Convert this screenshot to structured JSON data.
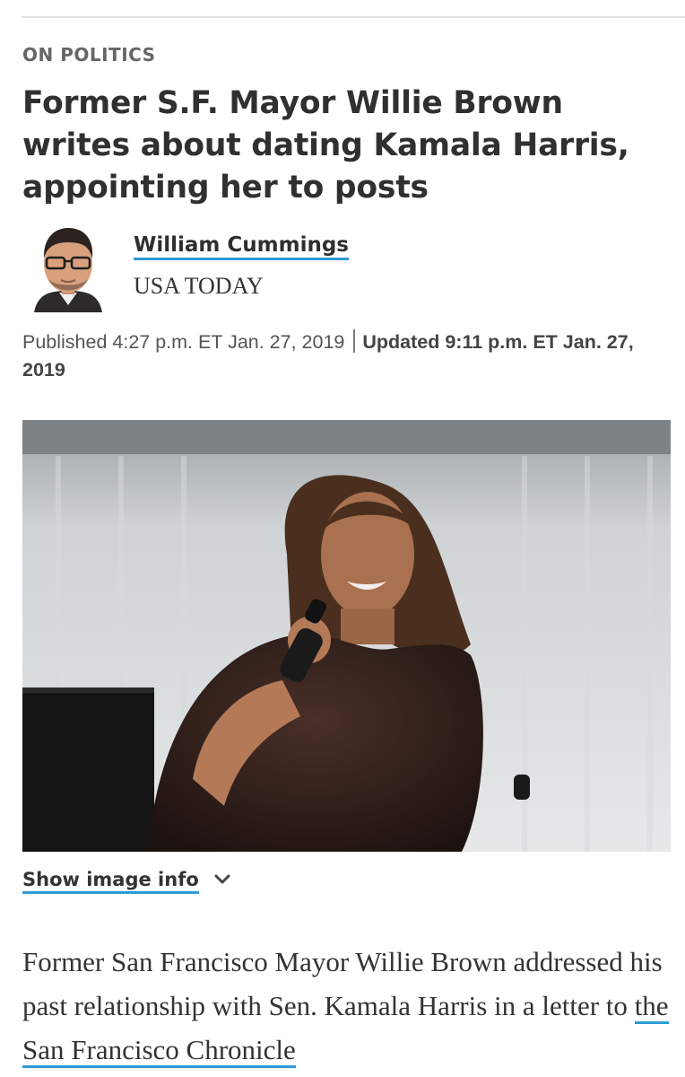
{
  "article": {
    "section": "ON POLITICS",
    "headline": "Former S.F. Mayor Willie Brown writes about dating Kamala Harris, appointing her to posts",
    "author": {
      "name": "William Cummings",
      "organization": "USA TODAY"
    },
    "published": "Published 4:27 p.m. ET Jan. 27, 2019",
    "updated": "Updated 9:11 p.m. ET Jan. 27, 2019",
    "image_info_label": "Show image info",
    "body_text": "Former San Francisco Mayor Willie Brown addressed his past relationship with Sen. Kamala Harris in a letter to",
    "body_link": "the San Francisco Chronicle"
  },
  "colors": {
    "link_underline": "#2e9ad8",
    "headline": "#303030",
    "section": "#666666"
  },
  "icons": {
    "expand": "chevron-down-icon"
  }
}
